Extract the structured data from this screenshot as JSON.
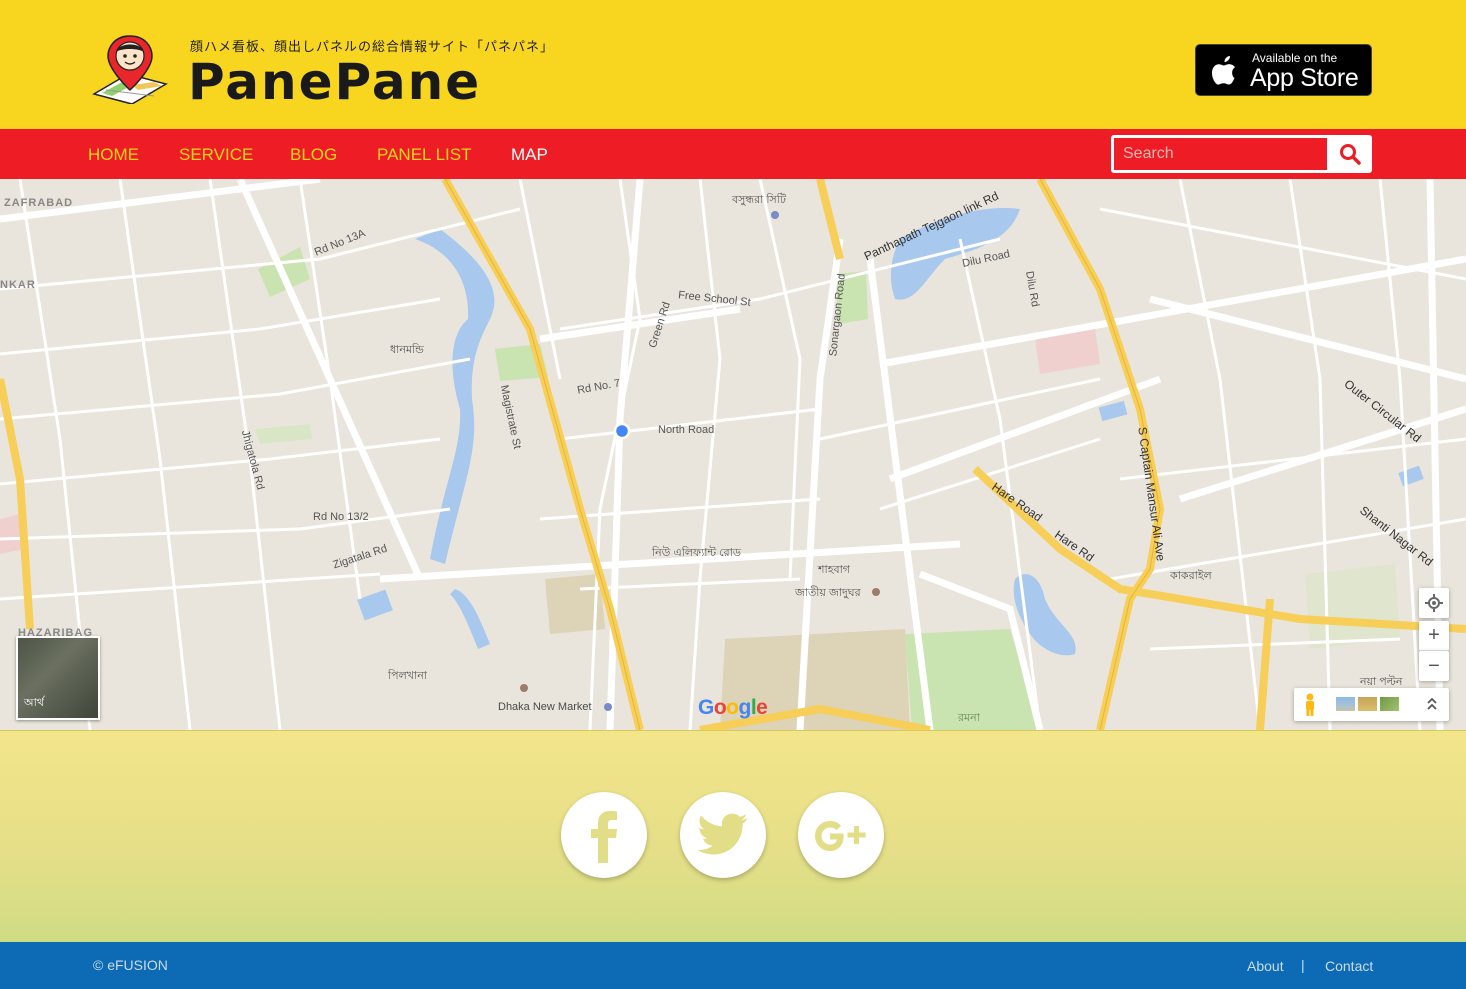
{
  "header": {
    "tagline": "顔ハメ看板、顔出しパネルの総合情報サイト「パネパネ」",
    "brand": "PanePane",
    "appstore": {
      "small": "Available on the",
      "big": "App Store"
    }
  },
  "nav": {
    "items": [
      {
        "label": "HOME"
      },
      {
        "label": "SERVICE"
      },
      {
        "label": "BLOG"
      },
      {
        "label": "PANEL LIST"
      },
      {
        "label": "MAP"
      }
    ],
    "active": "MAP"
  },
  "search": {
    "placeholder": "Search"
  },
  "map": {
    "satellite_label": "আর্থ",
    "google": "Google",
    "labels": [
      "ZAFRABAD",
      "NKAR",
      "HAZARIBAG",
      "Rd No 13A",
      "Rd No 13/2",
      "Zigatala Rd",
      "Jhigatola Rd",
      "Magistrate St",
      "Green Rd",
      "Free School St",
      "Rd No. 7",
      "North Road",
      "Sonargaon Road",
      "Panthapath Tejgaon link Rd",
      "Dilu Road",
      "Dilu Rd",
      "Hare Road",
      "Hare Rd",
      "S Captain Mansur Ali Ave",
      "Outer Circular Rd",
      "Shanti Nagar Rd",
      "Dhaka New Market",
      "বসুন্ধরা সিটি",
      "ধানমন্ডি",
      "কাকরাইল",
      "শাহবাগ",
      "নিউ এলিফ্যান্ট রোড",
      "জাতীয় জাদুঘর",
      "রমনা",
      "নয়া পল্টন",
      "পিলখানা"
    ]
  },
  "social": [
    {
      "name": "facebook",
      "icon": "facebook-icon"
    },
    {
      "name": "twitter",
      "icon": "twitter-icon"
    },
    {
      "name": "google-plus",
      "icon": "google-plus-icon"
    }
  ],
  "footer": {
    "copyright": "© eFUSION",
    "links": [
      {
        "label": "About"
      },
      {
        "label": "Contact"
      }
    ],
    "separator": "|"
  },
  "colors": {
    "header_bg": "#f8d61f",
    "nav_bg": "#ee1c25",
    "nav_text": "#f8d61f",
    "footer_bg": "#0d6ab4"
  }
}
